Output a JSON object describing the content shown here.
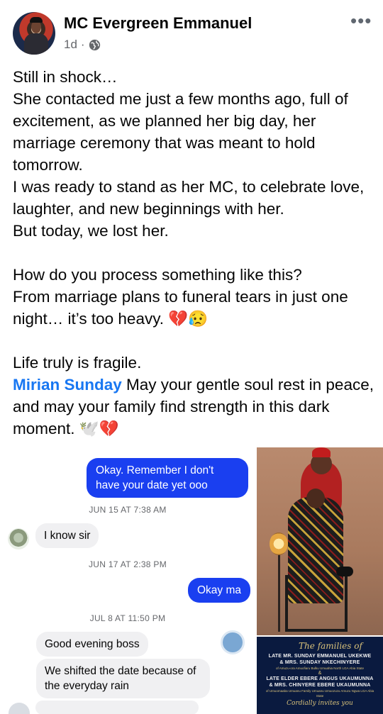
{
  "post": {
    "author": "MC Evergreen Emmanuel",
    "time": "1d",
    "separator": "·",
    "privacy_icon": "globe-icon",
    "more_icon": "more-horizontal-icon",
    "paragraphs": [
      "Still in shock…\nShe contacted me just a few months ago, full of excitement, as we planned her big day, her marriage ceremony that was meant to hold tomorrow.\nI was ready to stand as her MC, to celebrate love, laughter, and new beginnings with her.\nBut today, we lost her.",
      "How do you process something like this?\nFrom marriage plans to funeral tears in just one night… it’s too heavy. 💔😥",
      "Life truly is fragile."
    ],
    "mention": "Mirian Sunday",
    "closing": " May your gentle soul rest in peace, and may your family find strength in this dark moment. 🕊️💔"
  },
  "chat": {
    "messages": [
      {
        "type": "out",
        "text": "Okay. Remember I don't have your date yet ooo"
      },
      {
        "type": "stamp",
        "text": "JUN 15 AT 7:38 AM"
      },
      {
        "type": "in",
        "text": "I know sir"
      },
      {
        "type": "stamp",
        "text": "JUN 17 AT 2:38 PM"
      },
      {
        "type": "out",
        "text": "Okay ma"
      },
      {
        "type": "stamp",
        "text": "JUL 8 AT 11:50 PM"
      },
      {
        "type": "in",
        "text": "Good evening boss"
      },
      {
        "type": "in",
        "text": "We shifted the date because of the everyday rain"
      }
    ]
  },
  "invitation": {
    "heading": "The families of",
    "line1": "LATE MR. SUNDAY EMMANUEL UKEKWE",
    "line2": "& MRS. SUNDAY NKECHINYERE",
    "sub1": "of Amuzu-ora Amuofiaru Bulku Umuahia North LGA Abia State",
    "amp": "&",
    "line3": "LATE ELDER EBERE ANGUS UKAUMUNNA",
    "line4": "& MRS. CHINYERE EBERE UKAUMUNNA",
    "sub2": "of Umuomaaba Umuanu Family Umuanu Umuozuzu Amuzu Ngwa LGA Abia State",
    "invite": "Cordially invites you"
  }
}
